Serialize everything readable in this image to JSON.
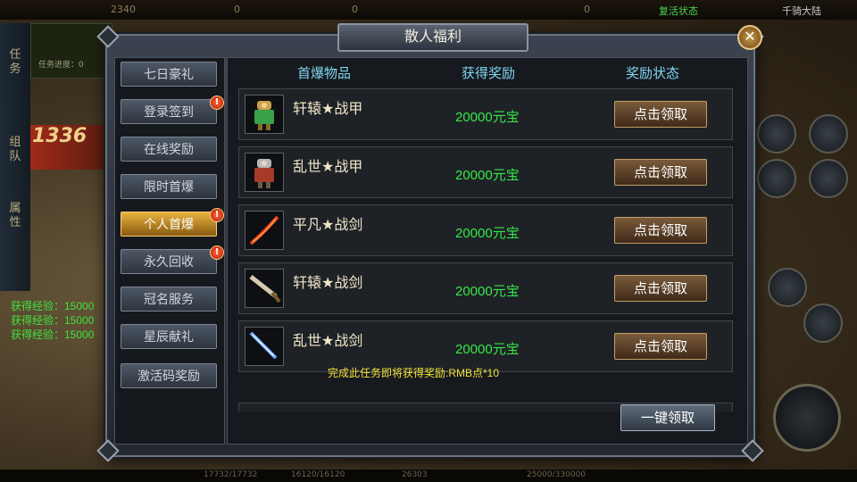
{
  "hud": {
    "top_values": [
      "2340",
      "0",
      "0",
      "0"
    ],
    "top_right_label": "复活状态",
    "top_right_name": "千骑大陆",
    "left_tabs": [
      "任务",
      "组队",
      "属性"
    ],
    "quest_progress_label": "任务进度：0",
    "banner_text": "1336",
    "exp_lines": [
      "获得经验：15000",
      "获得经验：15000",
      "获得经验：15000"
    ],
    "bottom_values": [
      "17732/17732",
      "16120/16120",
      "26303",
      "25000/330000"
    ]
  },
  "dialog": {
    "title": "散人福利",
    "close_glyph": "✕",
    "sidebar": [
      {
        "label": "七日豪礼",
        "badge": ""
      },
      {
        "label": "登录签到",
        "badge": "!"
      },
      {
        "label": "在线奖励",
        "badge": ""
      },
      {
        "label": "限时首爆",
        "badge": ""
      },
      {
        "label": "个人首爆",
        "badge": "!",
        "active": true
      },
      {
        "label": "永久回收",
        "badge": "!"
      },
      {
        "label": "冠名服务",
        "badge": ""
      },
      {
        "label": "星辰献礼",
        "badge": ""
      },
      {
        "label": "激活码奖励",
        "badge": ""
      }
    ],
    "columns": [
      "首爆物品",
      "获得奖励",
      "奖励状态"
    ],
    "rows": [
      {
        "icon": "armor-icon",
        "name": "轩辕★战甲",
        "reward": "20000元宝",
        "button": "点击领取"
      },
      {
        "icon": "armor-icon",
        "name": "乱世★战甲",
        "reward": "20000元宝",
        "button": "点击领取"
      },
      {
        "icon": "sword-icon",
        "name": "平凡★战剑",
        "reward": "20000元宝",
        "button": "点击领取"
      },
      {
        "icon": "sword-icon",
        "name": "轩辕★战剑",
        "reward": "20000元宝",
        "button": "点击领取"
      },
      {
        "icon": "sword-icon",
        "name": "乱世★战剑",
        "reward": "20000元宝",
        "button": "点击领取"
      }
    ],
    "task_hint": "完成此任务即将获得奖励:RMB点*10",
    "claim_all_label": "一键领取",
    "colors": {
      "reward": "#36e84a",
      "header": "#7fd8f0",
      "active_tab": "#e7b23e"
    }
  }
}
